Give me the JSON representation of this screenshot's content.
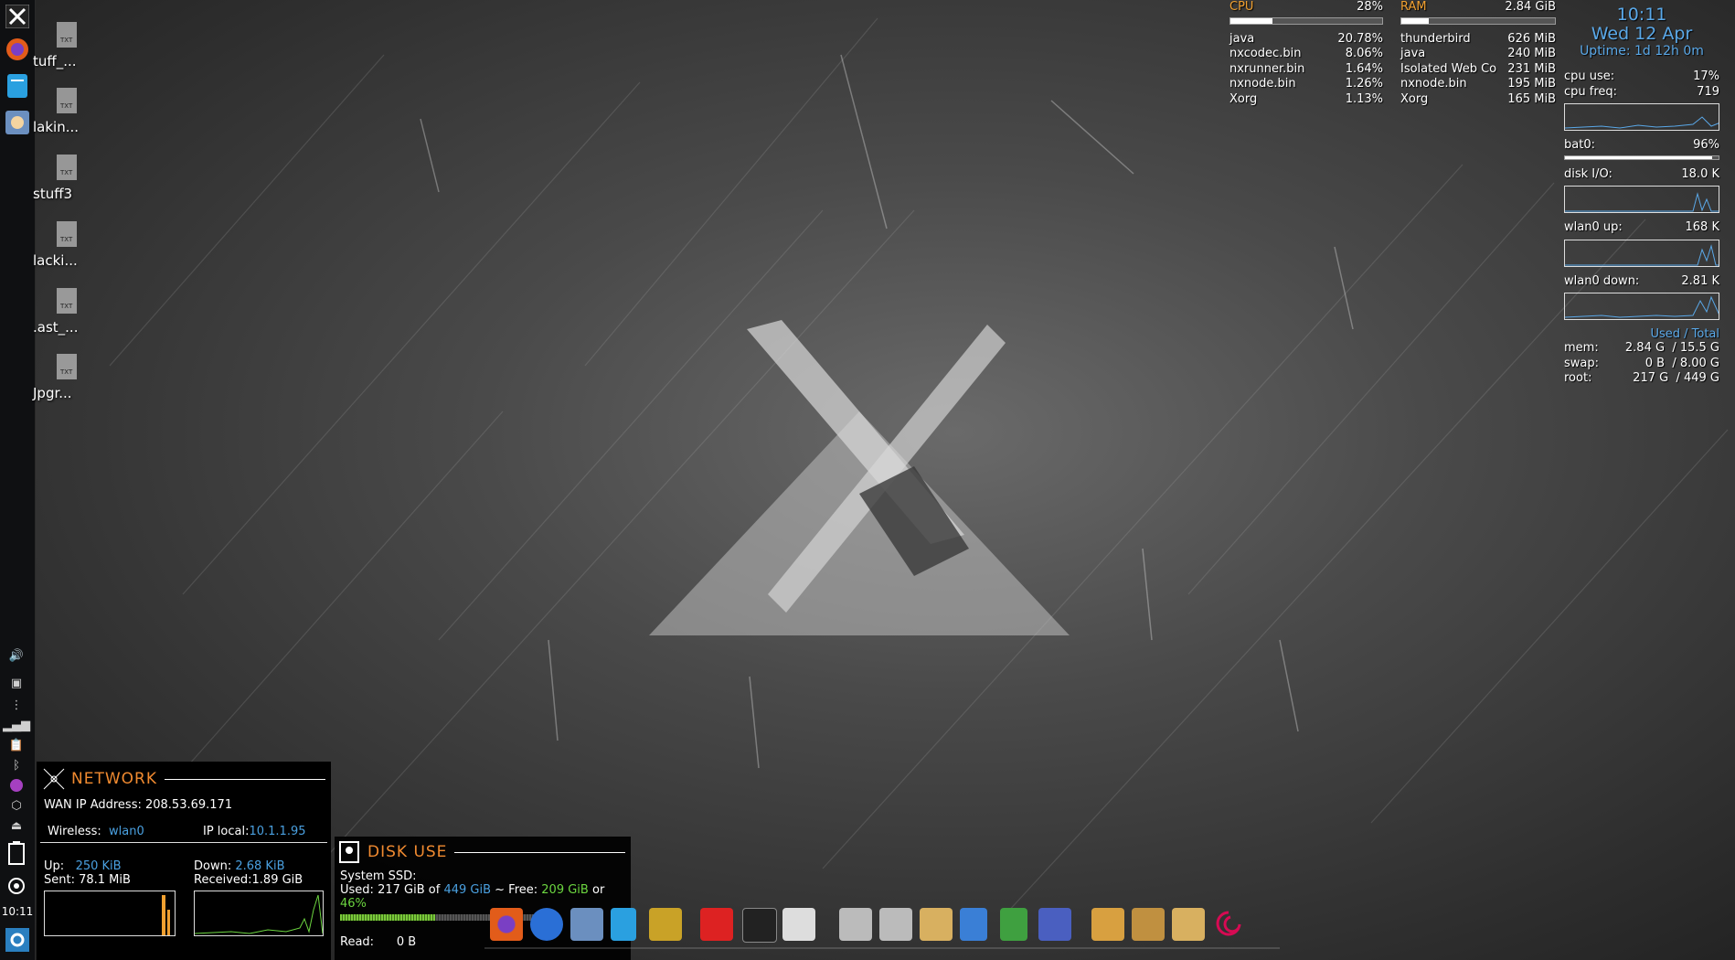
{
  "left_panel": {
    "clock": "10:11",
    "items": [
      "mx-menu-icon",
      "firefox-icon",
      "notes-icon",
      "finder-icon"
    ],
    "tray": [
      "microphone-icon",
      "volume-icon",
      "window-icon",
      "network-icon",
      "signal-icon",
      "clipboard-icon",
      "bluetooth-icon",
      "firefox-tray-icon",
      "box-icon",
      "eject-icon",
      "battery-icon",
      "update-icon",
      "settings-icon"
    ]
  },
  "desktop_icons": [
    {
      "label": "tuff_..."
    },
    {
      "label": "lakin..."
    },
    {
      "label": "stuff3"
    },
    {
      "label": "lacki..."
    },
    {
      "label": ".ast_..."
    },
    {
      "label": "Jpgr..."
    }
  ],
  "cpu": {
    "header": "CPU",
    "total": "28%",
    "fill": 0.28,
    "procs": [
      {
        "name": "java",
        "val": "20.78%"
      },
      {
        "name": "nxcodec.bin",
        "val": "8.06%"
      },
      {
        "name": "nxrunner.bin",
        "val": "1.64%"
      },
      {
        "name": "nxnode.bin",
        "val": "1.26%"
      },
      {
        "name": "Xorg",
        "val": "1.13%"
      }
    ]
  },
  "ram": {
    "header": "RAM",
    "total": "2.84 GiB",
    "fill": 0.18,
    "procs": [
      {
        "name": "thunderbird",
        "val": "626 MiB"
      },
      {
        "name": "java",
        "val": "240 MiB"
      },
      {
        "name": "Isolated Web Co",
        "val": "231 MiB"
      },
      {
        "name": "nxnode.bin",
        "val": "195 MiB"
      },
      {
        "name": "Xorg",
        "val": "165 MiB"
      }
    ]
  },
  "sysinfo": {
    "time": "10:11",
    "date": "Wed 12 Apr",
    "uptime": "Uptime: 1d 12h 0m",
    "cpu_use_label": "cpu use:",
    "cpu_use": "17%",
    "cpu_freq_label": "cpu freq:",
    "cpu_freq": "719",
    "bat_label": "bat0:",
    "bat": "96%",
    "bat_fill": 0.96,
    "disk_label": "disk I/O:",
    "disk": "18.0 K",
    "up_label": "wlan0 up:",
    "up": "168 K",
    "down_label": "wlan0 down:",
    "down": "2.81 K",
    "used_total": "Used / Total",
    "mem_label": "mem:",
    "mem_used": "2.84 G",
    "mem_total": "/ 15.5 G",
    "swap_label": "swap:",
    "swap_used": "0 B",
    "swap_total": "/ 8.00 G",
    "root_label": "root:",
    "root_used": "217 G",
    "root_total": "/ 449 G"
  },
  "network": {
    "title": "NETWORK",
    "wan": "WAN IP Address: 208.53.69.171",
    "wireless_label": "Wireless:",
    "wireless": "wlan0",
    "iplocal_label": "IP local:",
    "iplocal": "10.1.1.95",
    "up_label": "Up:",
    "up": "250 KiB",
    "sent": "Sent: 78.1 MiB",
    "down_label": "Down:",
    "down": "2.68 KiB",
    "received": "Received:1.89 GiB"
  },
  "disk": {
    "title": "DISK USE",
    "system": "System SSD:",
    "used_label": "Used:",
    "used": "217 GiB",
    "of": "of",
    "total": "449 GiB",
    "free_label": "~ Free:",
    "free": "209 GiB",
    "or": "or",
    "pct": "46%",
    "read_label": "Read:",
    "read": "0 B",
    "fill": 0.46
  },
  "dock": [
    "firefox",
    "signal",
    "finder",
    "notes",
    "image-viewer",
    "mx-red",
    "terminal",
    "text-editor",
    "archive1",
    "archive2",
    "folder",
    "writer",
    "calc",
    "screenshot",
    "home",
    "files",
    "folder2",
    "debian"
  ],
  "colors": {
    "accent_orange": "#f08a30",
    "accent_blue": "#4aa0e0",
    "accent_green": "#6cd640"
  }
}
